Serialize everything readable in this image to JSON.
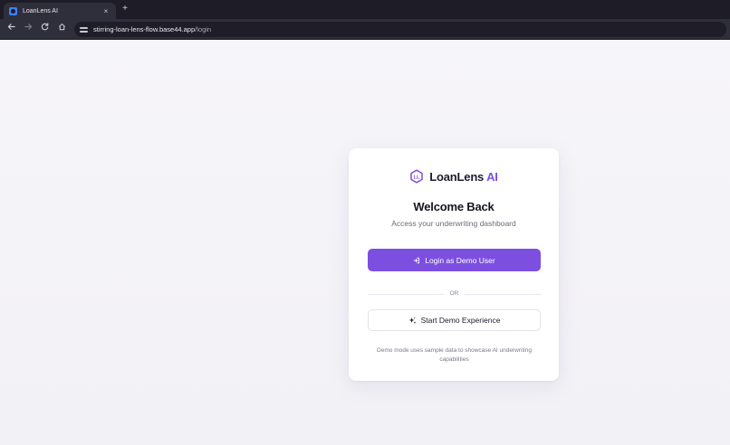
{
  "browser": {
    "tab_title": "LoanLens AI",
    "tab_close": "×",
    "new_tab": "+",
    "url_host": "stirring-loan-lens-flow.base44.app",
    "url_path": "/login"
  },
  "brand": {
    "name": "LoanLens",
    "accent": "AI",
    "logo_text": "LL"
  },
  "login": {
    "heading": "Welcome Back",
    "subheading": "Access your underwriting dashboard",
    "primary_button": "Login as Demo User",
    "divider": "OR",
    "secondary_button": "Start Demo Experience",
    "note": "Demo mode uses sample data to showcase AI underwriting capabilities"
  },
  "colors": {
    "accent": "#7c4fe0",
    "background": "#f3f2f7",
    "card": "#ffffff"
  },
  "icons": {
    "primary_button": "login-icon",
    "secondary_button": "sparkles-icon",
    "logo": "hexagon-logo-icon"
  }
}
